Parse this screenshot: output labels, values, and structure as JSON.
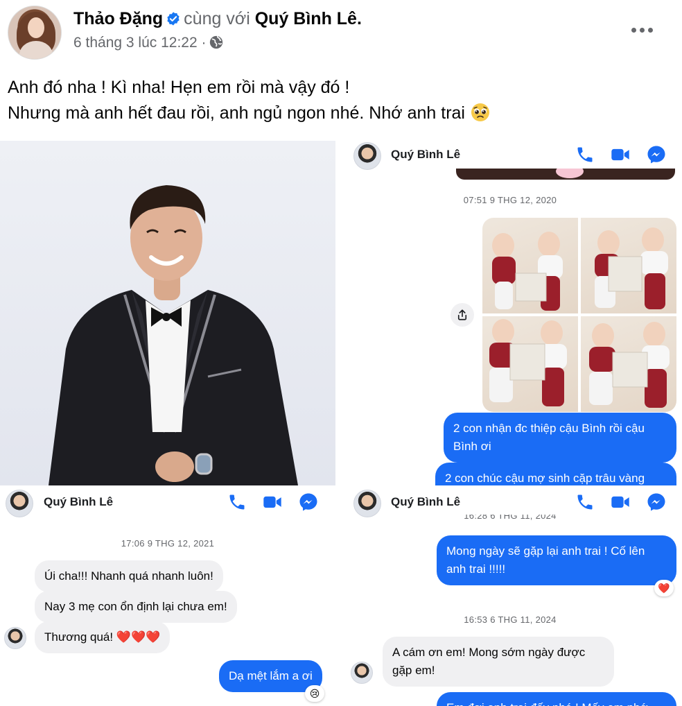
{
  "post": {
    "author": "Thảo Đặng",
    "with_text": "cùng với",
    "tagged": "Quý Bình Lê",
    "tagged_suffix": ".",
    "timestamp": "6 tháng 3 lúc 12:22 ·",
    "privacy_icon": "globe-icon",
    "caption_line1": "Anh đó nha ! Kì nha! Hẹn em rồi mà vậy đó !",
    "caption_line2": "Nhưng mà anh hết đau rồi, anh ngủ ngon nhé. Nhớ anh trai",
    "caption_emoji": "pleading-face-emoji"
  },
  "screenshots": {
    "top_right": {
      "contact": "Quý Bình Lê",
      "timestamp": "07:51 9 THG 12, 2020",
      "messages": [
        "2 con nhận đc thiệp cậu Bình rồi cậu Bình ơi",
        "2 con chúc cậu mợ sinh cặp trâu vàng"
      ]
    },
    "bottom_left": {
      "contact": "Quý Bình Lê",
      "timestamp": "17:06 9 THG 12, 2021",
      "incoming": [
        "Úi cha!!! Nhanh quá nhanh luôn!",
        "Nay 3 mẹ con ổn định lại chưa em!",
        "Thương quá! ❤️❤️❤️"
      ],
      "outgoing": "Dạ mệt lắm a ơi",
      "outgoing_reaction": "😢"
    },
    "bottom_right": {
      "contact": "Quý Bình Lê",
      "timestamp_partial": "16:28 6 THG 11, 2024",
      "outgoing_1": "Mong ngày sẽ gặp lại anh trai ! Cố lên anh trai !!!!!",
      "outgoing_1_reaction": "❤️",
      "timestamp": "16:53 6 THG 11, 2024",
      "incoming": "A cám ơn em! Mong sớm ngày được gặp em!",
      "outgoing_2_partial": "Em đợi anh trai đấy nhé ! Mấy em nhớ"
    }
  },
  "colors": {
    "messenger_blue": "#1a6cf5",
    "incoming_bubble": "#f0f0f2",
    "secondary_text": "#65676b",
    "verified_blue": "#1877f2"
  }
}
